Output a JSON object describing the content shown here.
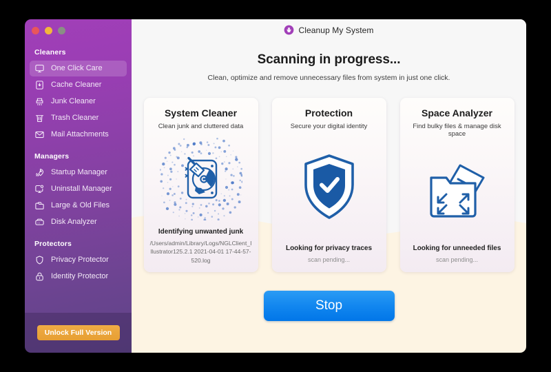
{
  "window": {
    "traffic_lights": [
      "close",
      "minimize",
      "zoom"
    ]
  },
  "sidebar": {
    "groups": [
      {
        "label": "Cleaners",
        "items": [
          {
            "label": "One Click Care",
            "icon": "monitor-icon",
            "active": true
          },
          {
            "label": "Cache Cleaner",
            "icon": "cache-box-icon",
            "active": false
          },
          {
            "label": "Junk Cleaner",
            "icon": "shredder-icon",
            "active": false
          },
          {
            "label": "Trash Cleaner",
            "icon": "trash-can-icon",
            "active": false
          },
          {
            "label": "Mail Attachments",
            "icon": "envelope-icon",
            "active": false
          }
        ]
      },
      {
        "label": "Managers",
        "items": [
          {
            "label": "Startup Manager",
            "icon": "rocket-icon",
            "active": false
          },
          {
            "label": "Uninstall Manager",
            "icon": "monitor-badge-icon",
            "active": false
          },
          {
            "label": "Large & Old Files",
            "icon": "folder-icon",
            "active": false
          },
          {
            "label": "Disk Analyzer",
            "icon": "hard-disk-icon",
            "active": false
          }
        ]
      },
      {
        "label": "Protectors",
        "items": [
          {
            "label": "Privacy Protector",
            "icon": "shield-icon",
            "active": false
          },
          {
            "label": "Identity Protector",
            "icon": "lock-icon",
            "active": false
          }
        ]
      }
    ],
    "unlock_button": "Unlock Full Version"
  },
  "header": {
    "logo_icon": "cleanup-app-logo-icon",
    "app_title": "Cleanup My System",
    "headline": "Scanning in progress...",
    "subhead": "Clean, optimize and remove unnecessary files from system in just one click."
  },
  "cards": [
    {
      "title": "System Cleaner",
      "subtitle": "Clean junk and cluttered data",
      "art_icon": "disk-broom-icon",
      "status": "Identifying unwanted junk",
      "detail": "/Users/admin/Library/Logs/NGLClient_Illustrator125.2.1 2021-04-01 17-44-57-520.log",
      "pending": false
    },
    {
      "title": "Protection",
      "subtitle": "Secure your digital identity",
      "art_icon": "shield-check-icon",
      "status": "Looking for privacy traces",
      "detail": "scan pending...",
      "pending": true
    },
    {
      "title": "Space Analyzer",
      "subtitle": "Find bulky files & manage disk space",
      "art_icon": "folder-expand-icon",
      "status": "Looking for unneeded files",
      "detail": "scan pending...",
      "pending": true
    }
  ],
  "action": {
    "stop_button": "Stop"
  },
  "colors": {
    "sidebar_top": "#a13fb8",
    "sidebar_bottom": "#5e4487",
    "unlock_orange": "#e79f33",
    "stop_blue": "#1186ef",
    "art_blue": "#1f5fa8",
    "main_cream": "#fdf4e3"
  }
}
